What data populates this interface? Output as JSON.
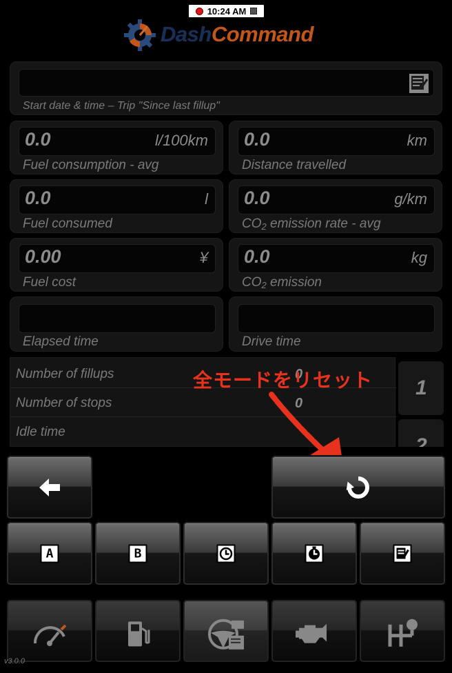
{
  "status_bar": {
    "time": "10:24 AM"
  },
  "app": {
    "logo_dash": "Dash",
    "logo_command": "Command",
    "version": "v3.0.0"
  },
  "trip": {
    "start_label": "Start date & time – Trip \"Since last fillup\""
  },
  "metrics": {
    "fuel_avg": {
      "value": "0.0",
      "unit": "l/100km",
      "label": "Fuel consumption - avg"
    },
    "distance": {
      "value": "0.0",
      "unit": "km",
      "label": "Distance travelled"
    },
    "fuel_consumed": {
      "value": "0.0",
      "unit": "l",
      "label": "Fuel consumed"
    },
    "co2_rate": {
      "value": "0.0",
      "unit": "g/km",
      "label_pre": "CO",
      "label_sub": "2",
      "label_post": " emission rate - avg"
    },
    "fuel_cost": {
      "value": "0.00",
      "unit": "¥",
      "label": "Fuel cost"
    },
    "co2": {
      "value": "0.0",
      "unit": "kg",
      "label_pre": "CO",
      "label_sub": "2",
      "label_post": " emission"
    },
    "elapsed": {
      "label": "Elapsed time"
    },
    "drive": {
      "label": "Drive time"
    }
  },
  "stats": {
    "rows": [
      {
        "label": "Number of fillups",
        "value": "0"
      },
      {
        "label": "Number of stops",
        "value": "0"
      },
      {
        "label": "Idle time",
        "value": ""
      }
    ],
    "pages": [
      "1",
      "2"
    ]
  },
  "annotation": {
    "text": "全モードをリセット",
    "color": "#e8321e"
  },
  "mode_buttons": [
    "A",
    "B"
  ],
  "colors": {
    "accent": "#c4561a",
    "logo_blue": "#1b2f55",
    "annotation_red": "#e8321e"
  }
}
